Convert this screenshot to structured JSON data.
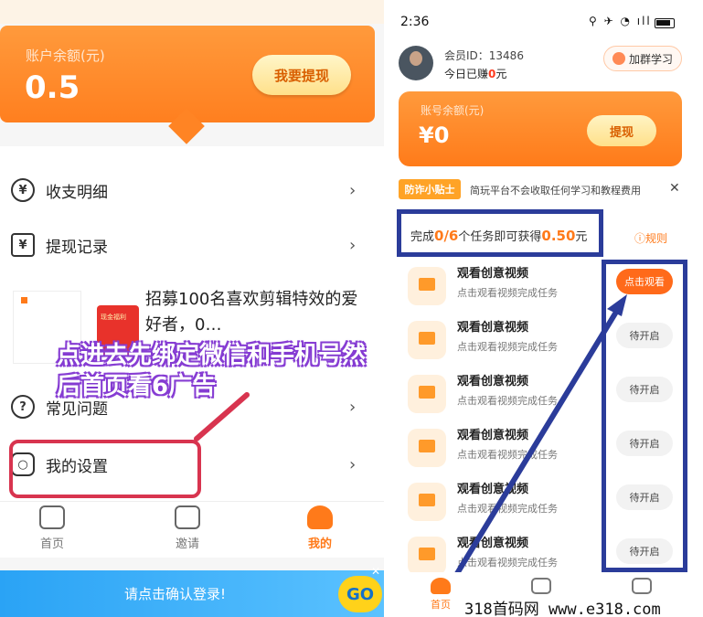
{
  "left": {
    "balance": {
      "label": "账户余额(元)",
      "value": "0.5",
      "withdraw_button": "我要提现"
    },
    "menu": [
      {
        "label": "收支明细",
        "icon": "yen-coin-icon"
      },
      {
        "label": "提现记录",
        "icon": "receipt-icon"
      },
      {
        "label": "常见问题",
        "icon": "question-icon"
      },
      {
        "label": "我的设置",
        "icon": "settings-icon"
      }
    ],
    "ad": {
      "text": "招募100名喜欢剪辑特效的爱好者，0…",
      "badge": "现金福利"
    },
    "overlay_instruction": "点进去先绑定微信和手机号然后首页看6广告",
    "nav": [
      {
        "label": "首页"
      },
      {
        "label": "邀请"
      },
      {
        "label": "我的"
      }
    ],
    "login_banner": "请点击确认登录!",
    "go_label": "GO"
  },
  "right": {
    "status_time": "2:36",
    "member_id": "会员ID：13486",
    "earned_prefix": "今日已赚",
    "earned_value": "0",
    "earned_unit": "元",
    "group_button": "加群学习",
    "balance": {
      "label": "账号余额(元)",
      "value": "¥0",
      "withdraw_button": "提现"
    },
    "tip": {
      "badge": "防诈小贴士",
      "text": "简玩平台不会收取任何学习和教程费用",
      "close": "✕"
    },
    "progress": {
      "prefix": "完成",
      "count": "0/6",
      "middle": "个任务即可获得",
      "reward": "0.50",
      "unit": "元"
    },
    "rules_link": "ⓘ规则",
    "tasks": [
      {
        "title": "观看创意视频",
        "subtitle": "点击观看视频完成任务",
        "button": "点击观看",
        "active": true
      },
      {
        "title": "观看创意视频",
        "subtitle": "点击观看视频完成任务",
        "button": "待开启",
        "active": false
      },
      {
        "title": "观看创意视频",
        "subtitle": "点击观看视频完成任务",
        "button": "待开启",
        "active": false
      },
      {
        "title": "观看创意视频",
        "subtitle": "点击观看视频完成任务",
        "button": "待开启",
        "active": false
      },
      {
        "title": "观看创意视频",
        "subtitle": "点击观看视频完成任务",
        "button": "待开启",
        "active": false
      },
      {
        "title": "观看创意视频",
        "subtitle": "点击观看视频完成任务",
        "button": "待开启",
        "active": false
      }
    ],
    "nav_home": "首页"
  },
  "watermark": "318首码网  www.e318.com"
}
